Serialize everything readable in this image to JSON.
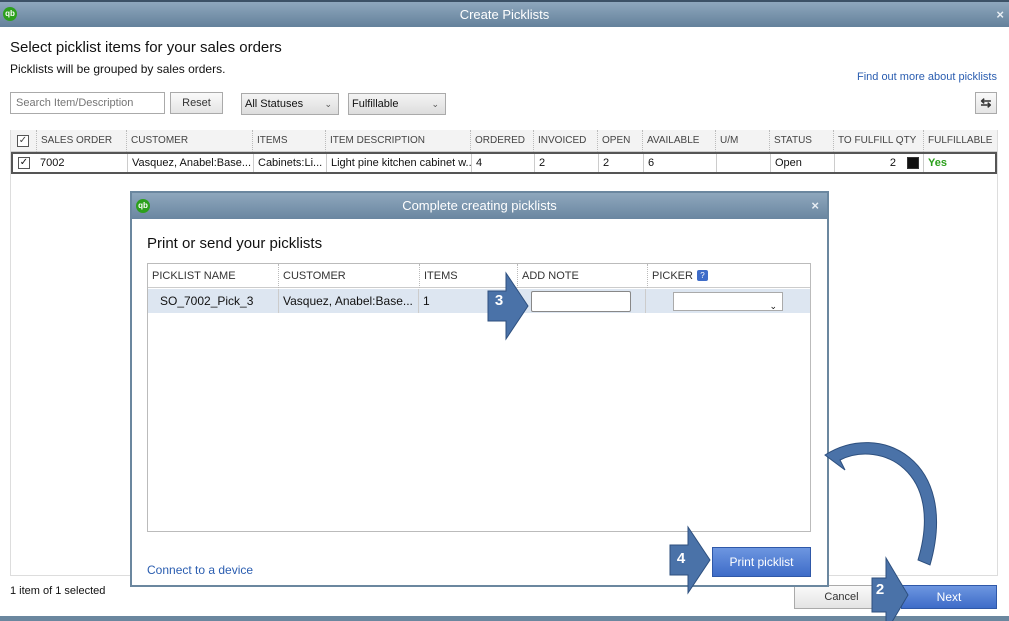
{
  "window": {
    "title": "Create Picklists",
    "close": "×"
  },
  "header": {
    "heading": "Select picklist items for your sales orders",
    "subheading": "Picklists will be grouped by sales orders.",
    "help_link": "Find out more about picklists"
  },
  "filters": {
    "search_placeholder": "Search Item/Description",
    "reset_label": "Reset",
    "status_selected": "All Statuses",
    "fulfill_selected": "Fulfillable"
  },
  "table": {
    "columns": [
      "SALES ORDER",
      "CUSTOMER",
      "ITEMS",
      "ITEM DESCRIPTION",
      "ORDERED",
      "INVOICED",
      "OPEN",
      "AVAILABLE",
      "U/M",
      "STATUS",
      "TO FULFILL QTY",
      "FULFILLABLE"
    ],
    "rows": [
      {
        "sales_order": "7002",
        "customer": "Vasquez, Anabel:Base...",
        "items": "Cabinets:Li...",
        "description": "Light pine kitchen cabinet w...",
        "ordered": "4",
        "invoiced": "2",
        "open": "2",
        "available": "6",
        "um": "",
        "status": "Open",
        "to_fulfill": "2",
        "fulfillable": "Yes"
      }
    ]
  },
  "footer": {
    "selection": "1 item of 1 selected",
    "cancel_label": "Cancel",
    "next_label": "Next"
  },
  "modal": {
    "title": "Complete creating picklists",
    "close": "×",
    "heading": "Print or send your picklists",
    "columns": [
      "PICKLIST NAME",
      "CUSTOMER",
      "ITEMS",
      "ADD NOTE",
      "PICKER"
    ],
    "help_badge": "?",
    "rows": [
      {
        "name": "SO_7002_Pick_3",
        "customer": "Vasquez, Anabel:Base...",
        "items": "1",
        "note": "",
        "picker": ""
      }
    ],
    "connect_link": "Connect to a device",
    "print_label": "Print picklist"
  },
  "callouts": {
    "step2": "2",
    "step3": "3",
    "step4": "4"
  },
  "colors": {
    "accent": "#3e6cc8",
    "yes": "#2ca01c",
    "callout": "#4a72a8"
  }
}
